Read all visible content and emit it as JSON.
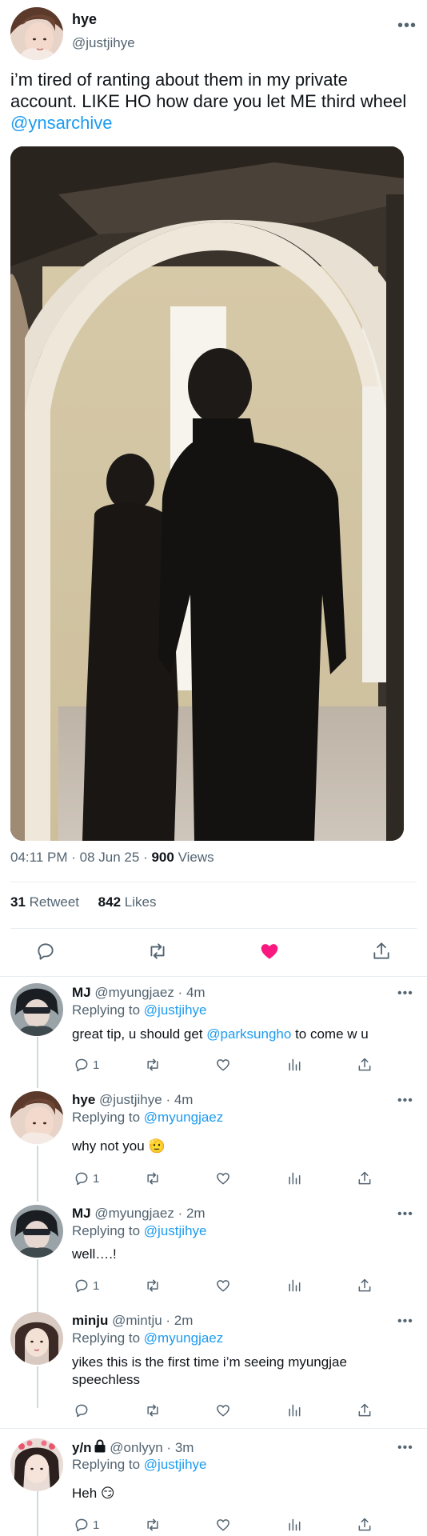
{
  "tweet": {
    "author_name": "hye",
    "author_handle": "@justjihye",
    "text_before": "i’m tired of ranting about them in my private account. LIKE HO how dare you let ME third wheel ",
    "mention": "@ynsarchive",
    "time": "04:11 PM",
    "date": "08 Jun 25",
    "views_count": "900",
    "views_label": "Views",
    "retweets_count": "31",
    "retweets_label": "Retweet",
    "likes_count": "842",
    "likes_label": "Likes",
    "liked": true
  },
  "icons": {
    "more": "more-icon",
    "reply": "reply-icon",
    "retweet": "retweet-icon",
    "like": "heart-icon",
    "share": "share-icon",
    "views": "views-icon"
  },
  "colors": {
    "accent": "#1d9bf0",
    "like_active": "#f91880",
    "muted": "#536471",
    "divider": "#e6ecf0"
  },
  "replies": [
    {
      "name": "MJ",
      "handle": "@myungjaez",
      "time": "4m",
      "replying_label": "Replying to",
      "replying_to": "@justjihye",
      "text_before": "great tip, u should get ",
      "mention": "@parksungho",
      "text_after": " to come w u",
      "reply_count": "1"
    },
    {
      "name": "hye",
      "handle": "@justjihye",
      "time": "4m",
      "replying_label": "Replying to",
      "replying_to": "@myungjaez",
      "text": "why not you 🫡",
      "reply_count": "1"
    },
    {
      "name": "MJ",
      "handle": "@myungjaez",
      "time": "2m",
      "replying_label": "Replying to",
      "replying_to": "@justjihye",
      "text": "well….!",
      "reply_count": "1"
    },
    {
      "name": "minju",
      "handle": "@mintju",
      "time": "2m",
      "replying_label": "Replying to",
      "replying_to": "@myungjaez",
      "text": "yikes this is the first time i’m seeing myungjae speechless",
      "reply_count": ""
    },
    {
      "name": "y/n",
      "handle": "@onlyyn",
      "time": "3m",
      "replying_label": "Replying to",
      "replying_to": "@justjihye",
      "text": "Heh 😏",
      "reply_count": "1",
      "locked": true
    }
  ]
}
